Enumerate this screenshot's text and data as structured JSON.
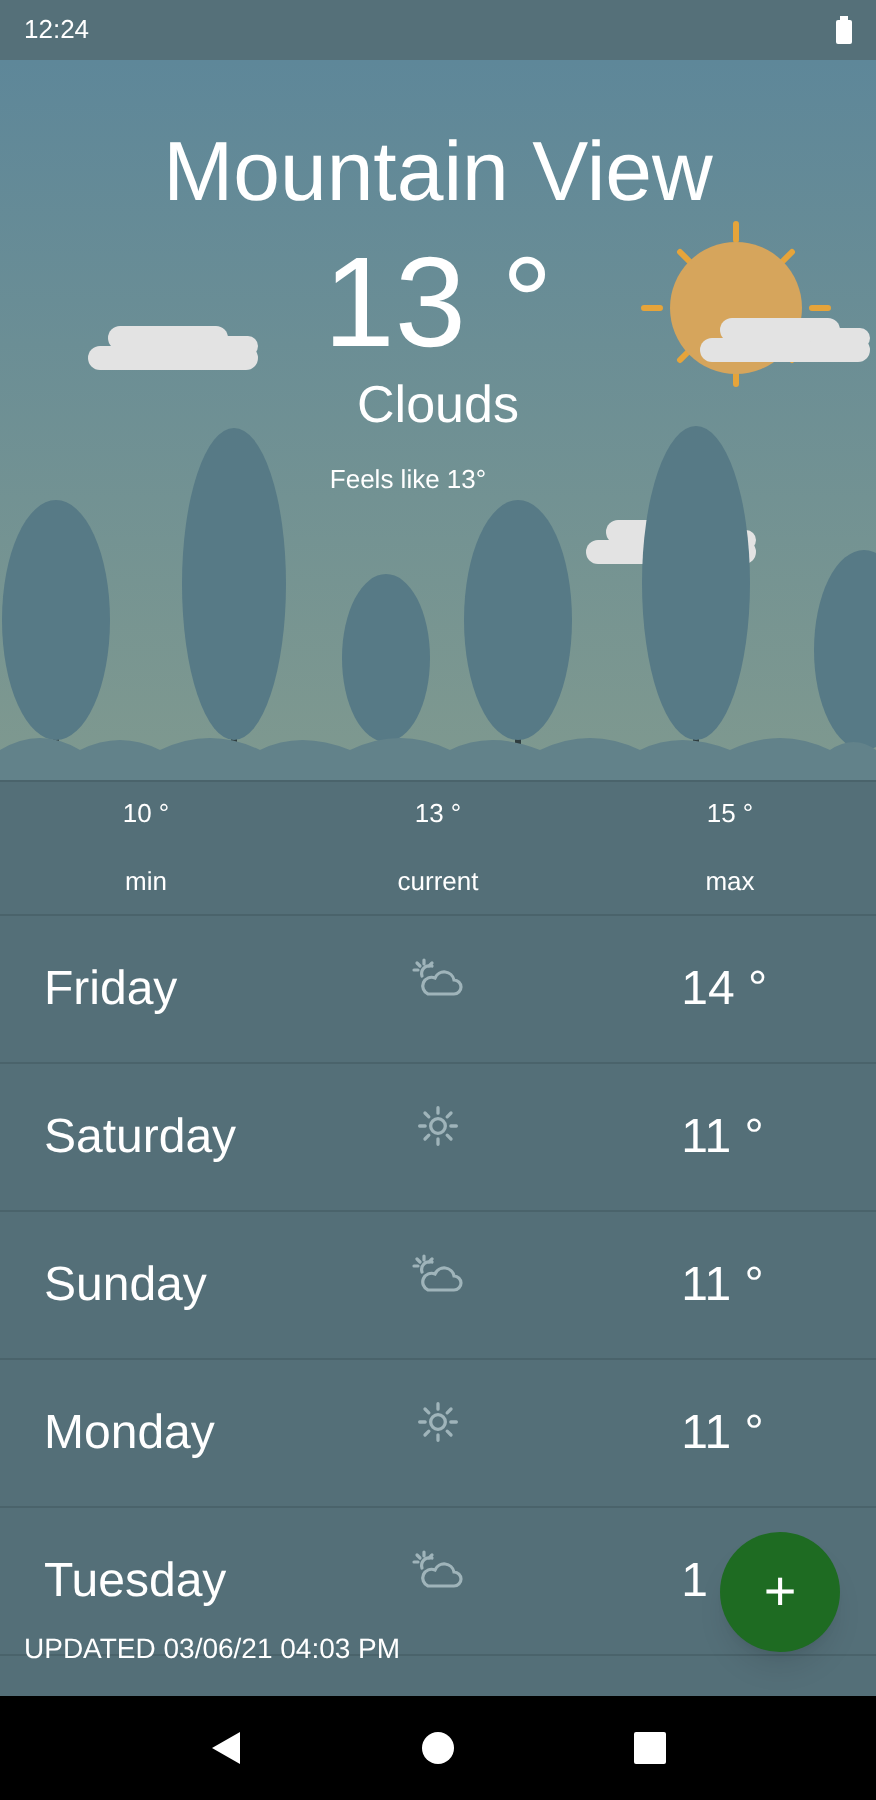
{
  "status_bar": {
    "time": "12:24"
  },
  "current": {
    "city": "Mountain View",
    "temperature": "13 °",
    "condition": "Clouds",
    "feels_like": "Feels like 13°"
  },
  "summary": [
    {
      "value": "10 °",
      "label": "min"
    },
    {
      "value": "13 °",
      "label": "current"
    },
    {
      "value": "15 °",
      "label": "max"
    }
  ],
  "forecast": [
    {
      "day": "Friday",
      "kind": "cloud_sun",
      "temperature": "14 °"
    },
    {
      "day": "Saturday",
      "kind": "sun",
      "temperature": "11 °"
    },
    {
      "day": "Sunday",
      "kind": "cloud_sun",
      "temperature": "11 °"
    },
    {
      "day": "Monday",
      "kind": "sun",
      "temperature": "11 °"
    },
    {
      "day": "Tuesday",
      "kind": "cloud_sun",
      "temperature": "1"
    }
  ],
  "updated": "UPDATED 03/06/21 04:03 PM",
  "fab": {
    "label": "+"
  }
}
